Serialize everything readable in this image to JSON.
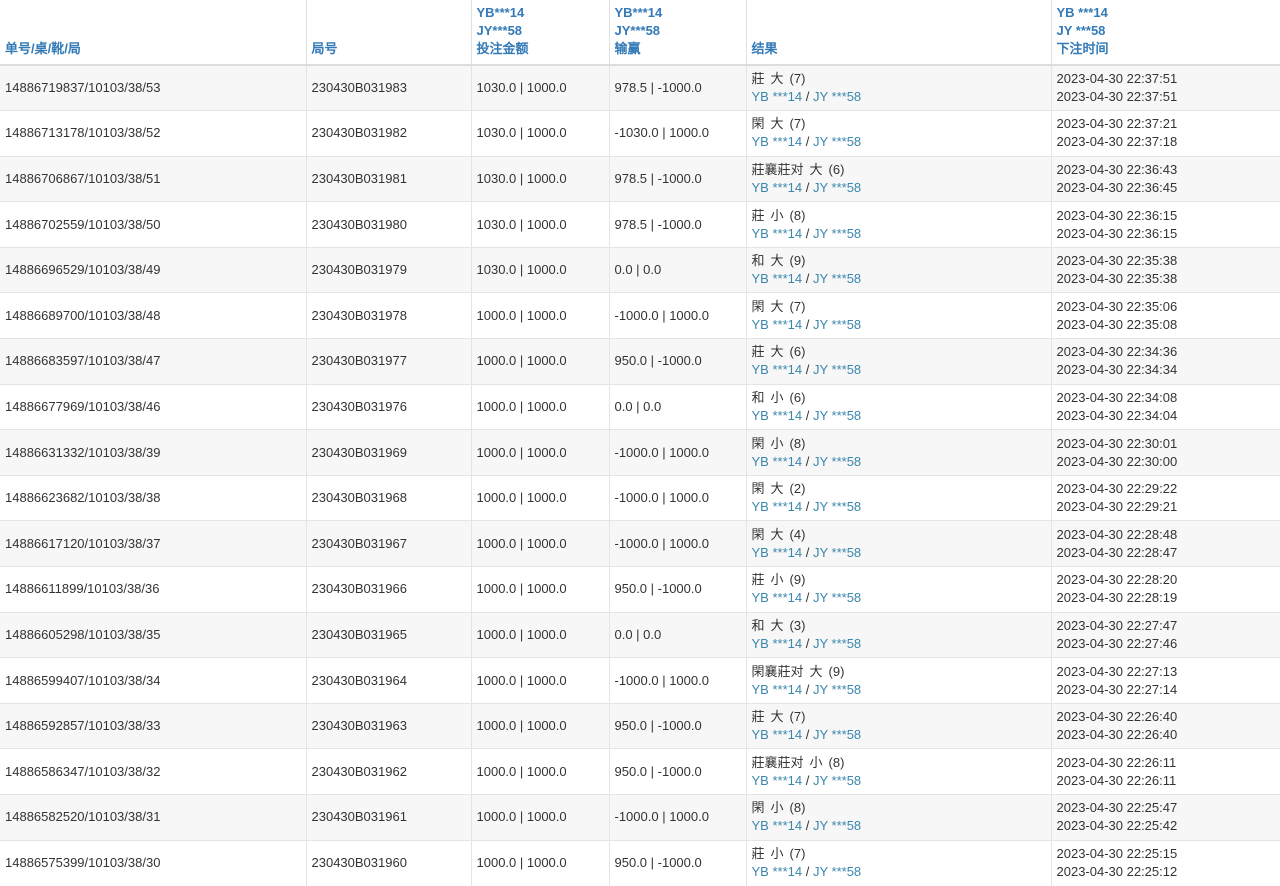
{
  "header": {
    "order": "单号/桌/靴/局",
    "round": "局号",
    "bet": [
      "YB***14",
      "JY***58",
      "投注金额"
    ],
    "win": [
      "YB***14",
      "JY***58",
      "输赢"
    ],
    "result": "结果",
    "time": [
      "YB ***14",
      "JY ***58",
      "下注时间"
    ]
  },
  "result_accounts": {
    "a": "YB ***14",
    "sep": "/",
    "b": "JY ***58"
  },
  "rows": [
    {
      "order": "14886719837/10103/38/53",
      "round": "230430B031983",
      "bet": "1030.0 | 1000.0",
      "win": "978.5 | -1000.0",
      "r1": "莊",
      "r2": "大",
      "r3": "(7)",
      "t1": "2023-04-30 22:37:51",
      "t2": "2023-04-30 22:37:51"
    },
    {
      "order": "14886713178/10103/38/52",
      "round": "230430B031982",
      "bet": "1030.0 | 1000.0",
      "win": "-1030.0 | 1000.0",
      "r1": "閑",
      "r2": "大",
      "r3": "(7)",
      "t1": "2023-04-30 22:37:21",
      "t2": "2023-04-30 22:37:18"
    },
    {
      "order": "14886706867/10103/38/51",
      "round": "230430B031981",
      "bet": "1030.0 | 1000.0",
      "win": "978.5 | -1000.0",
      "r1": "莊襄莊对",
      "r2": "大",
      "r3": "(6)",
      "t1": "2023-04-30 22:36:43",
      "t2": "2023-04-30 22:36:45"
    },
    {
      "order": "14886702559/10103/38/50",
      "round": "230430B031980",
      "bet": "1030.0 | 1000.0",
      "win": "978.5 | -1000.0",
      "r1": "莊",
      "r2": "小",
      "r3": "(8)",
      "t1": "2023-04-30 22:36:15",
      "t2": "2023-04-30 22:36:15"
    },
    {
      "order": "14886696529/10103/38/49",
      "round": "230430B031979",
      "bet": "1030.0 | 1000.0",
      "win": "0.0 | 0.0",
      "r1": "和",
      "r2": "大",
      "r3": "(9)",
      "t1": "2023-04-30 22:35:38",
      "t2": "2023-04-30 22:35:38"
    },
    {
      "order": "14886689700/10103/38/48",
      "round": "230430B031978",
      "bet": "1000.0 | 1000.0",
      "win": "-1000.0 | 1000.0",
      "r1": "閑",
      "r2": "大",
      "r3": "(7)",
      "t1": "2023-04-30 22:35:06",
      "t2": "2023-04-30 22:35:08"
    },
    {
      "order": "14886683597/10103/38/47",
      "round": "230430B031977",
      "bet": "1000.0 | 1000.0",
      "win": "950.0 | -1000.0",
      "r1": "莊",
      "r2": "大",
      "r3": "(6)",
      "t1": "2023-04-30 22:34:36",
      "t2": "2023-04-30 22:34:34"
    },
    {
      "order": "14886677969/10103/38/46",
      "round": "230430B031976",
      "bet": "1000.0 | 1000.0",
      "win": "0.0 | 0.0",
      "r1": "和",
      "r2": "小",
      "r3": "(6)",
      "t1": "2023-04-30 22:34:08",
      "t2": "2023-04-30 22:34:04"
    },
    {
      "order": "14886631332/10103/38/39",
      "round": "230430B031969",
      "bet": "1000.0 | 1000.0",
      "win": "-1000.0 | 1000.0",
      "r1": "閑",
      "r2": "小",
      "r3": "(8)",
      "t1": "2023-04-30 22:30:01",
      "t2": "2023-04-30 22:30:00"
    },
    {
      "order": "14886623682/10103/38/38",
      "round": "230430B031968",
      "bet": "1000.0 | 1000.0",
      "win": "-1000.0 | 1000.0",
      "r1": "閑",
      "r2": "大",
      "r3": "(2)",
      "t1": "2023-04-30 22:29:22",
      "t2": "2023-04-30 22:29:21"
    },
    {
      "order": "14886617120/10103/38/37",
      "round": "230430B031967",
      "bet": "1000.0 | 1000.0",
      "win": "-1000.0 | 1000.0",
      "r1": "閑",
      "r2": "大",
      "r3": "(4)",
      "t1": "2023-04-30 22:28:48",
      "t2": "2023-04-30 22:28:47"
    },
    {
      "order": "14886611899/10103/38/36",
      "round": "230430B031966",
      "bet": "1000.0 | 1000.0",
      "win": "950.0 | -1000.0",
      "r1": "莊",
      "r2": "小",
      "r3": "(9)",
      "t1": "2023-04-30 22:28:20",
      "t2": "2023-04-30 22:28:19"
    },
    {
      "order": "14886605298/10103/38/35",
      "round": "230430B031965",
      "bet": "1000.0 | 1000.0",
      "win": "0.0 | 0.0",
      "r1": "和",
      "r2": "大",
      "r3": "(3)",
      "t1": "2023-04-30 22:27:47",
      "t2": "2023-04-30 22:27:46"
    },
    {
      "order": "14886599407/10103/38/34",
      "round": "230430B031964",
      "bet": "1000.0 | 1000.0",
      "win": "-1000.0 | 1000.0",
      "r1": "閑襄莊对",
      "r2": "大",
      "r3": "(9)",
      "t1": "2023-04-30 22:27:13",
      "t2": "2023-04-30 22:27:14"
    },
    {
      "order": "14886592857/10103/38/33",
      "round": "230430B031963",
      "bet": "1000.0 | 1000.0",
      "win": "950.0 | -1000.0",
      "r1": "莊",
      "r2": "大",
      "r3": "(7)",
      "t1": "2023-04-30 22:26:40",
      "t2": "2023-04-30 22:26:40"
    },
    {
      "order": "14886586347/10103/38/32",
      "round": "230430B031962",
      "bet": "1000.0 | 1000.0",
      "win": "950.0 | -1000.0",
      "r1": "莊襄莊对",
      "r2": "小",
      "r3": "(8)",
      "t1": "2023-04-30 22:26:11",
      "t2": "2023-04-30 22:26:11"
    },
    {
      "order": "14886582520/10103/38/31",
      "round": "230430B031961",
      "bet": "1000.0 | 1000.0",
      "win": "-1000.0 | 1000.0",
      "r1": "閑",
      "r2": "小",
      "r3": "(8)",
      "t1": "2023-04-30 22:25:47",
      "t2": "2023-04-30 22:25:42"
    },
    {
      "order": "14886575399/10103/38/30",
      "round": "230430B031960",
      "bet": "1000.0 | 1000.0",
      "win": "950.0 | -1000.0",
      "r1": "莊",
      "r2": "小",
      "r3": "(7)",
      "t1": "2023-04-30 22:25:15",
      "t2": "2023-04-30 22:25:12"
    }
  ]
}
